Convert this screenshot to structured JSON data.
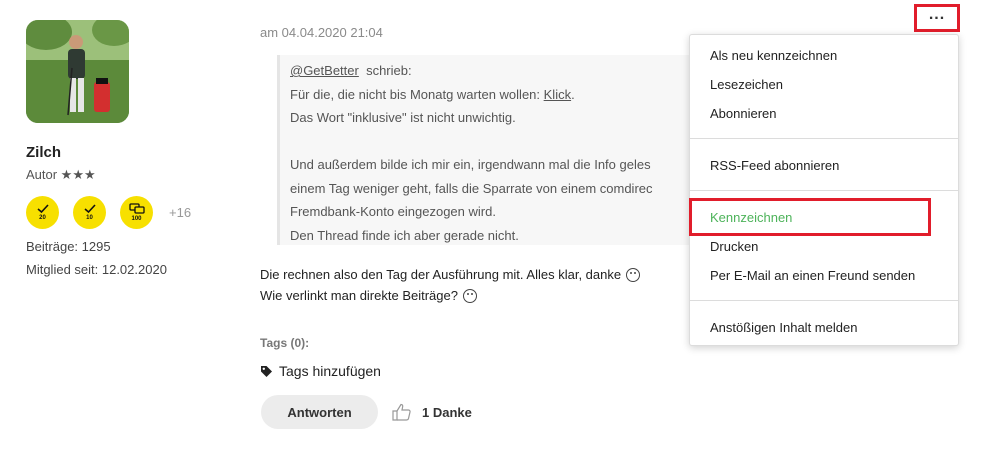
{
  "author": {
    "name": "Zilch",
    "rank": "Autor ★★★",
    "badges": [
      {
        "icon": "check-icon",
        "count": "20"
      },
      {
        "icon": "check-icon",
        "count": "10"
      },
      {
        "icon": "speech-bubbles-icon",
        "count": "100"
      }
    ],
    "badges_more": "+16",
    "posts_label": "Beiträge: 1295",
    "member_since_label": "Mitglied seit: 12.02.2020"
  },
  "post": {
    "date": "am 04.04.2020 21:04",
    "quote": {
      "mention": "@GetBetter",
      "wrote": "schrieb:",
      "line1_prefix": "Für die, die nicht bis Monatg warten wollen: ",
      "line1_link": "Klick",
      "line1_suffix": ".",
      "line2": "Das Wort \"inklusive\" ist nicht unwichtig.",
      "line3": "Und außerdem bilde ich mir ein, irgendwann mal die Info geles",
      "line4": "einem Tag weniger geht, falls die Sparrate von einem comdirec",
      "line5": "Fremdbank-Konto eingezogen wird.",
      "line6": "Den Thread finde ich aber gerade nicht."
    },
    "body_line1": "Die rechnen also den Tag der Ausführung mit. Alles klar, danke",
    "body_line2": "Wie verlinkt man direkte Beiträge?",
    "tags_label": "Tags (0):",
    "add_tags_label": "Tags hinzufügen",
    "reply_label": "Antworten",
    "likes_label": "1 Danke"
  },
  "menu": {
    "items": [
      "Als neu kennzeichnen",
      "Lesezeichen",
      "Abonnieren",
      "RSS-Feed abonnieren",
      "Kennzeichnen",
      "Drucken",
      "Per E-Mail an einen Freund senden",
      "Anstößigen Inhalt melden"
    ],
    "more_icon": "ellipsis-icon"
  },
  "colors": {
    "badge_yellow": "#f7e000",
    "highlight_red": "#e11d2b",
    "accent_green": "#4db35a"
  }
}
